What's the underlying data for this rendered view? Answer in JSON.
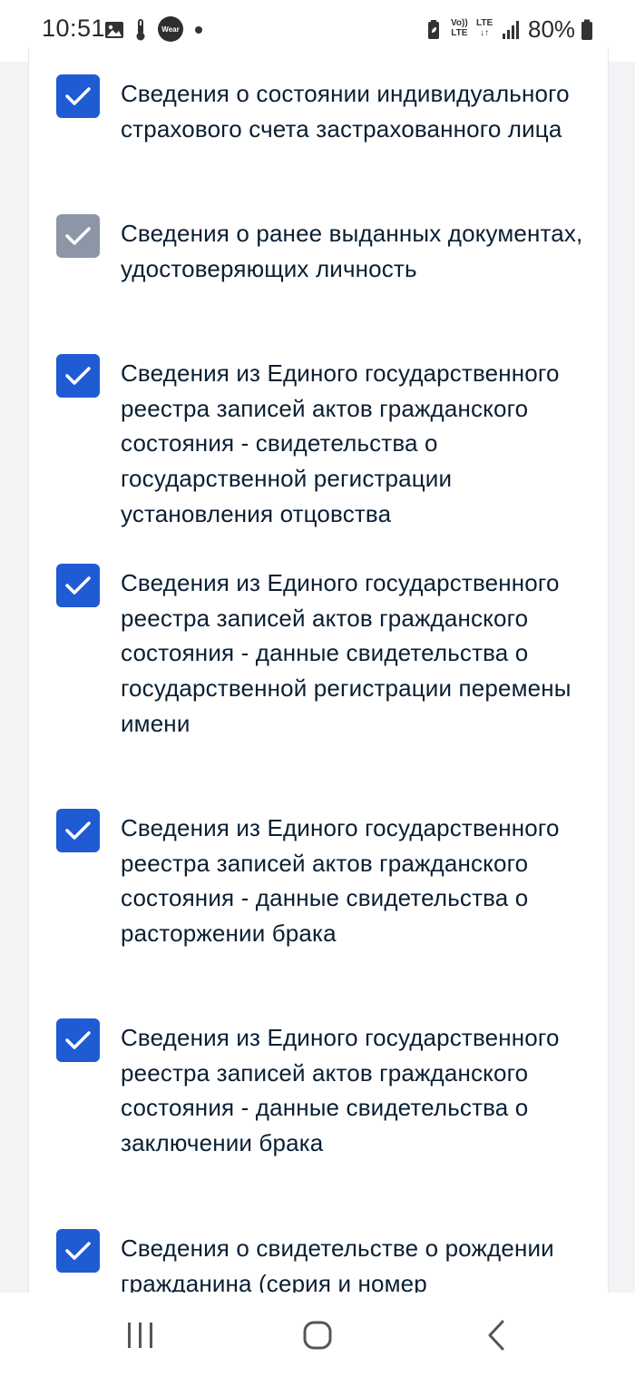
{
  "status_bar": {
    "time": "10:51",
    "wear_label": "Wear",
    "volte_label_top": "Vo))",
    "volte_label_bottom": "LTE",
    "lte_label": "LTE",
    "battery_percent": "80%"
  },
  "items": [
    {
      "text": "Сведения о состоянии индивидуального страхового счета застрахованного лица",
      "checked": true,
      "disabled": false
    },
    {
      "text": "Сведения о ранее выданных документах, удостоверяющих личность",
      "checked": true,
      "disabled": true
    },
    {
      "text": "Сведения из Единого государственного реестра записей актов гражданского состояния - свидетельства о государственной регистрации установления отцовства",
      "checked": true,
      "disabled": false
    },
    {
      "text": "Сведения из Единого государственного реестра записей актов гражданского состояния - данные свидетельства о государственной регистрации перемены имени",
      "checked": true,
      "disabled": false
    },
    {
      "text": "Сведения из Единого государственного реестра записей актов гражданского состояния - данные свидетельства о расторжении брака",
      "checked": true,
      "disabled": false
    },
    {
      "text": "Сведения из Единого государственного реестра записей актов гражданского состояния - данные свидетельства о заключении брака",
      "checked": true,
      "disabled": false
    },
    {
      "text": "Сведения о свидетельстве о рождении гражданина (серия и номер",
      "checked": true,
      "disabled": false
    }
  ],
  "nav_bar": {
    "recents_icon": "recents-icon",
    "home_icon": "home-icon",
    "back_icon": "back-icon"
  },
  "colors": {
    "checkbox_checked": "#1f5bd3",
    "checkbox_disabled": "#8c96a6",
    "text": "#0b1f33"
  }
}
